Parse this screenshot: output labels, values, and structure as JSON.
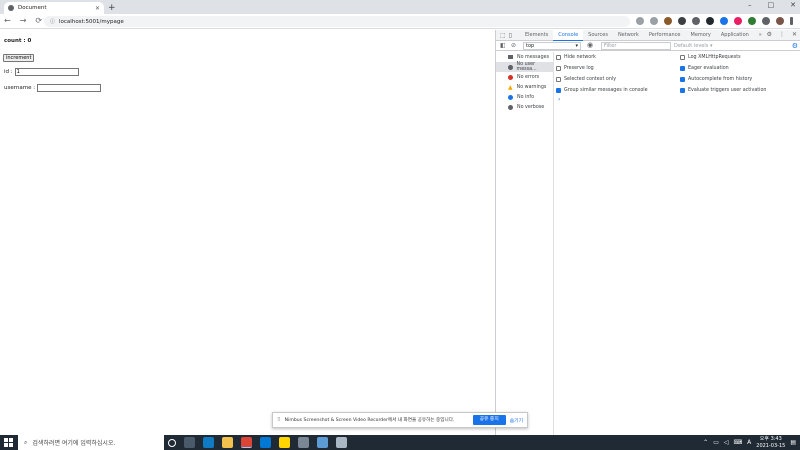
{
  "browser": {
    "tab_title": "Document",
    "new_tab": "+",
    "url": "localhost:5001/mypage",
    "window_controls": [
      "–",
      "□",
      "✕"
    ],
    "nav": {
      "back": "←",
      "forward": "→",
      "reload": "⟳"
    }
  },
  "page": {
    "count_label": "count : 0",
    "increment_label": "increment",
    "id_label": "id :",
    "id_value": "1",
    "username_label": "username :",
    "username_value": ""
  },
  "devtools": {
    "tabs": [
      "Elements",
      "Console",
      "Sources",
      "Network",
      "Performance",
      "Memory",
      "Application"
    ],
    "active_tab": "Console",
    "more": "»",
    "context": "top",
    "filter_placeholder": "Filter",
    "levels": "Default levels ▾",
    "sidebar": [
      {
        "label": "No messages",
        "icon": "list-icon",
        "color": "#5f6368"
      },
      {
        "label": "No user messa...",
        "icon": "user-icon",
        "color": "#5f6368",
        "selected": true
      },
      {
        "label": "No errors",
        "icon": "error-icon",
        "color": "#d93025"
      },
      {
        "label": "No warnings",
        "icon": "warning-icon",
        "color": "#f9ab00"
      },
      {
        "label": "No info",
        "icon": "info-icon",
        "color": "#1a73e8"
      },
      {
        "label": "No verbose",
        "icon": "verbose-icon",
        "color": "#5f6368"
      }
    ],
    "settings_left": [
      {
        "label": "Hide network",
        "checked": false
      },
      {
        "label": "Preserve log",
        "checked": false
      },
      {
        "label": "Selected context only",
        "checked": false
      },
      {
        "label": "Group similar messages in console",
        "checked": true
      }
    ],
    "settings_right": [
      {
        "label": "Log XMLHttpRequests",
        "checked": false
      },
      {
        "label": "Eager evaluation",
        "checked": true
      },
      {
        "label": "Autocomplete from history",
        "checked": true
      },
      {
        "label": "Evaluate triggers user activation",
        "checked": true
      }
    ],
    "prompt": "›"
  },
  "notification": {
    "message": "Nimbus Screenshot & Screen Video Recorder에서 내 화면을 공유하는 중입니다.",
    "stop_label": "공유 중지",
    "hide_label": "숨기기"
  },
  "taskbar": {
    "search_placeholder": "검색하려면 여기에 입력하십시오.",
    "time": "오후 3:43",
    "date": "2021-03-15",
    "ime": "A"
  },
  "colors": {
    "accent": "#1a73e8",
    "taskbar": "#1f2a35"
  }
}
